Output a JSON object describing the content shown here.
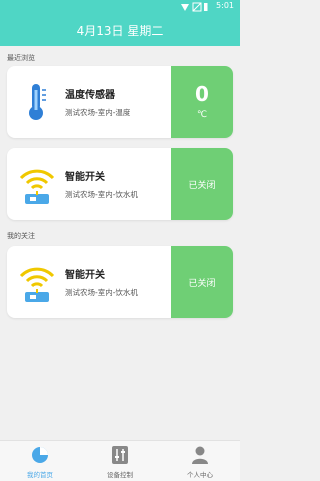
{
  "status_bar": {
    "time": "5:01"
  },
  "header": {
    "title": "4月13日 星期二"
  },
  "sections": {
    "recent_label": "最近浏览",
    "follow_label": "我的关注"
  },
  "cards": [
    {
      "icon": "thermometer-icon",
      "name": "温度传感器",
      "location": "测试农场-室内-温度",
      "value": "0",
      "unit": "℃"
    },
    {
      "icon": "wifi-switch-icon",
      "name": "智能开关",
      "location": "测试农场-室内-饮水机",
      "state": "已关闭"
    },
    {
      "icon": "wifi-switch-icon",
      "name": "智能开关",
      "location": "测试农场-室内-饮水机",
      "state": "已关闭"
    }
  ],
  "tabs": [
    {
      "label": "我的首页",
      "icon": "pie-chart-icon",
      "active": true
    },
    {
      "label": "设备控制",
      "icon": "sliders-icon",
      "active": false
    },
    {
      "label": "个人中心",
      "icon": "person-icon",
      "active": false
    }
  ],
  "colors": {
    "accent": "#4fd6c5",
    "status_panel": "#6fcf75",
    "active_tab": "#4aa8e8"
  }
}
